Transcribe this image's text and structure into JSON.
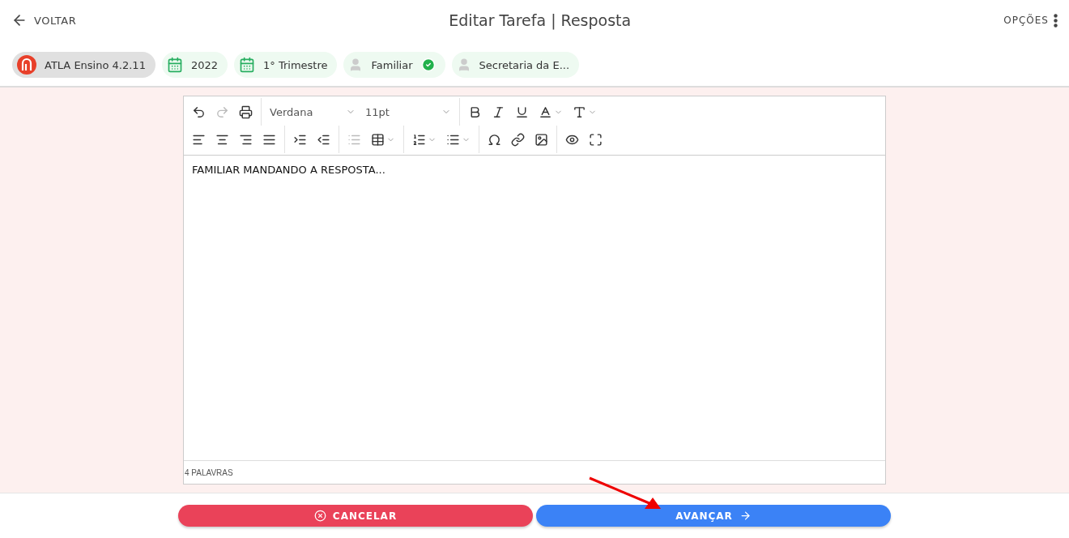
{
  "header": {
    "back": "VOLTAR",
    "title": "Editar Tarefa | Resposta",
    "options": "OPÇÕES"
  },
  "chips": [
    {
      "kind": "logo",
      "label": "ATLA Ensino 4.2.11",
      "verified": false
    },
    {
      "kind": "calendar",
      "label": "2022",
      "verified": false
    },
    {
      "kind": "calendar",
      "label": "1° Trimestre",
      "verified": false
    },
    {
      "kind": "person",
      "label": "Familiar",
      "verified": true
    },
    {
      "kind": "person",
      "label": "Secretaria da E...",
      "verified": false
    }
  ],
  "toolbar": {
    "rows": [
      [
        [
          {
            "kind": "button",
            "disabled": false,
            "dropdown": false
          },
          {
            "kind": "button",
            "disabled": true,
            "dropdown": false
          },
          {
            "kind": "button",
            "disabled": false,
            "dropdown": false
          }
        ],
        [
          {
            "kind": "select",
            "value": "Verdana"
          },
          {
            "kind": "select",
            "value": "11pt"
          }
        ],
        [
          {
            "kind": "button",
            "disabled": false,
            "dropdown": false
          },
          {
            "kind": "button",
            "disabled": false,
            "dropdown": false
          },
          {
            "kind": "button",
            "disabled": false,
            "dropdown": false
          },
          {
            "kind": "button",
            "disabled": false,
            "dropdown": true
          },
          {
            "kind": "button",
            "disabled": false,
            "dropdown": true
          }
        ]
      ],
      [
        [
          {
            "kind": "button",
            "disabled": false,
            "dropdown": false
          },
          {
            "kind": "button",
            "disabled": false,
            "dropdown": false
          },
          {
            "kind": "button",
            "disabled": false,
            "dropdown": false
          },
          {
            "kind": "button",
            "disabled": false,
            "dropdown": false
          }
        ],
        [
          {
            "kind": "button",
            "disabled": false,
            "dropdown": false
          },
          {
            "kind": "button",
            "disabled": false,
            "dropdown": false
          }
        ],
        [
          {
            "kind": "button",
            "disabled": true,
            "dropdown": false
          },
          {
            "kind": "button",
            "disabled": false,
            "dropdown": true
          }
        ],
        [
          {
            "kind": "button",
            "disabled": false,
            "dropdown": true
          },
          {
            "kind": "button",
            "disabled": false,
            "dropdown": true
          }
        ],
        [
          {
            "kind": "button",
            "disabled": false,
            "dropdown": false
          },
          {
            "kind": "button",
            "disabled": false,
            "dropdown": false
          },
          {
            "kind": "button",
            "disabled": false,
            "dropdown": false
          }
        ],
        [
          {
            "kind": "button",
            "disabled": false,
            "dropdown": false
          },
          {
            "kind": "button",
            "disabled": false,
            "dropdown": false
          }
        ]
      ]
    ]
  },
  "editor": {
    "content": "FAMILIAR MANDANDO A RESPOSTA...",
    "status": "4 PALAVRAS"
  },
  "buttons": [
    {
      "kind": "cancel",
      "label": "CANCELAR"
    },
    {
      "kind": "next",
      "label": "AVANÇAR"
    }
  ]
}
